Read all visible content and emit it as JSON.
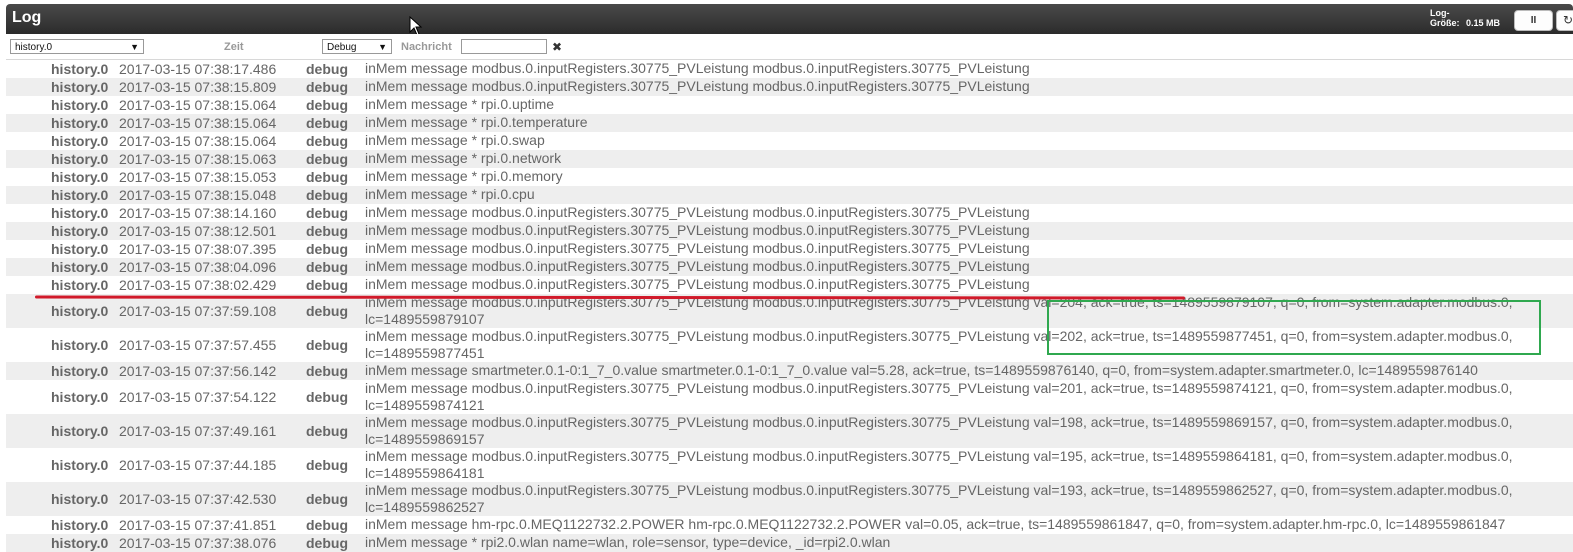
{
  "window": {
    "title": "Log"
  },
  "header": {
    "log_size_label": "Log-",
    "log_size_label2": "Größe:",
    "log_size_value": "0.15 MB",
    "pause_label": "II",
    "refresh_icon": "refresh-icon"
  },
  "filters": {
    "source_value": "history.0",
    "time_header": "Zeit",
    "level_value": "Debug",
    "message_header": "Nachricht",
    "message_filter_value": "",
    "clear_icon": "✖"
  },
  "colors": {
    "titlebar": "#333333",
    "row_alt": "#eeeeee",
    "text": "#666666",
    "annotation_red": "#d11a2a",
    "annotation_green": "#2fa84f"
  },
  "log": {
    "rows": [
      {
        "source": "history.0",
        "time": "2017-03-15 07:38:17.486",
        "level": "debug",
        "message": "inMem message modbus.0.inputRegisters.30775_PVLeistung modbus.0.inputRegisters.30775_PVLeistung"
      },
      {
        "source": "history.0",
        "time": "2017-03-15 07:38:15.809",
        "level": "debug",
        "message": "inMem message modbus.0.inputRegisters.30775_PVLeistung modbus.0.inputRegisters.30775_PVLeistung"
      },
      {
        "source": "history.0",
        "time": "2017-03-15 07:38:15.064",
        "level": "debug",
        "message": "inMem message * rpi.0.uptime"
      },
      {
        "source": "history.0",
        "time": "2017-03-15 07:38:15.064",
        "level": "debug",
        "message": "inMem message * rpi.0.temperature"
      },
      {
        "source": "history.0",
        "time": "2017-03-15 07:38:15.064",
        "level": "debug",
        "message": "inMem message * rpi.0.swap"
      },
      {
        "source": "history.0",
        "time": "2017-03-15 07:38:15.063",
        "level": "debug",
        "message": "inMem message * rpi.0.network"
      },
      {
        "source": "history.0",
        "time": "2017-03-15 07:38:15.053",
        "level": "debug",
        "message": "inMem message * rpi.0.memory"
      },
      {
        "source": "history.0",
        "time": "2017-03-15 07:38:15.048",
        "level": "debug",
        "message": "inMem message * rpi.0.cpu"
      },
      {
        "source": "history.0",
        "time": "2017-03-15 07:38:14.160",
        "level": "debug",
        "message": "inMem message modbus.0.inputRegisters.30775_PVLeistung modbus.0.inputRegisters.30775_PVLeistung"
      },
      {
        "source": "history.0",
        "time": "2017-03-15 07:38:12.501",
        "level": "debug",
        "message": "inMem message modbus.0.inputRegisters.30775_PVLeistung modbus.0.inputRegisters.30775_PVLeistung"
      },
      {
        "source": "history.0",
        "time": "2017-03-15 07:38:07.395",
        "level": "debug",
        "message": "inMem message modbus.0.inputRegisters.30775_PVLeistung modbus.0.inputRegisters.30775_PVLeistung"
      },
      {
        "source": "history.0",
        "time": "2017-03-15 07:38:04.096",
        "level": "debug",
        "message": "inMem message modbus.0.inputRegisters.30775_PVLeistung modbus.0.inputRegisters.30775_PVLeistung"
      },
      {
        "source": "history.0",
        "time": "2017-03-15 07:38:02.429",
        "level": "debug",
        "message": "inMem message modbus.0.inputRegisters.30775_PVLeistung modbus.0.inputRegisters.30775_PVLeistung"
      },
      {
        "source": "history.0",
        "time": "2017-03-15 07:37:59.108",
        "level": "debug",
        "message": "inMem message modbus.0.inputRegisters.30775_PVLeistung modbus.0.inputRegisters.30775_PVLeistung val=204, ack=true, ts=1489559879107, q=0, from=system.adapter.modbus.0, lc=1489559879107"
      },
      {
        "source": "history.0",
        "time": "2017-03-15 07:37:57.455",
        "level": "debug",
        "message": "inMem message modbus.0.inputRegisters.30775_PVLeistung modbus.0.inputRegisters.30775_PVLeistung val=202, ack=true, ts=1489559877451, q=0, from=system.adapter.modbus.0, lc=1489559877451"
      },
      {
        "source": "history.0",
        "time": "2017-03-15 07:37:56.142",
        "level": "debug",
        "message": "inMem message smartmeter.0.1-0:1_7_0.value smartmeter.0.1-0:1_7_0.value val=5.28, ack=true, ts=1489559876140, q=0, from=system.adapter.smartmeter.0, lc=1489559876140"
      },
      {
        "source": "history.0",
        "time": "2017-03-15 07:37:54.122",
        "level": "debug",
        "message": "inMem message modbus.0.inputRegisters.30775_PVLeistung modbus.0.inputRegisters.30775_PVLeistung val=201, ack=true, ts=1489559874121, q=0, from=system.adapter.modbus.0, lc=1489559874121"
      },
      {
        "source": "history.0",
        "time": "2017-03-15 07:37:49.161",
        "level": "debug",
        "message": "inMem message modbus.0.inputRegisters.30775_PVLeistung modbus.0.inputRegisters.30775_PVLeistung val=198, ack=true, ts=1489559869157, q=0, from=system.adapter.modbus.0, lc=1489559869157"
      },
      {
        "source": "history.0",
        "time": "2017-03-15 07:37:44.185",
        "level": "debug",
        "message": "inMem message modbus.0.inputRegisters.30775_PVLeistung modbus.0.inputRegisters.30775_PVLeistung val=195, ack=true, ts=1489559864181, q=0, from=system.adapter.modbus.0, lc=1489559864181"
      },
      {
        "source": "history.0",
        "time": "2017-03-15 07:37:42.530",
        "level": "debug",
        "message": "inMem message modbus.0.inputRegisters.30775_PVLeistung modbus.0.inputRegisters.30775_PVLeistung val=193, ack=true, ts=1489559862527, q=0, from=system.adapter.modbus.0, lc=1489559862527"
      },
      {
        "source": "history.0",
        "time": "2017-03-15 07:37:41.851",
        "level": "debug",
        "message": "inMem message hm-rpc.0.MEQ1122732.2.POWER hm-rpc.0.MEQ1122732.2.POWER val=0.05, ack=true, ts=1489559861847, q=0, from=system.adapter.hm-rpc.0, lc=1489559861847"
      },
      {
        "source": "history.0",
        "time": "2017-03-15 07:37:38.076",
        "level": "debug",
        "message": "inMem message * rpi2.0.wlan name=wlan, role=sensor, type=device, _id=rpi2.0.wlan"
      }
    ]
  }
}
